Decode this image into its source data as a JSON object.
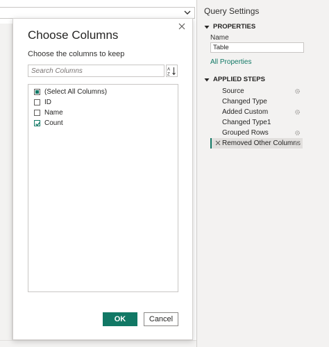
{
  "dialog": {
    "title": "Choose Columns",
    "subtitle": "Choose the columns to keep",
    "search_placeholder": "Search Columns",
    "columns": [
      {
        "label": "(Select All Columns)",
        "state": "partial"
      },
      {
        "label": "ID",
        "state": "unchecked"
      },
      {
        "label": "Name",
        "state": "unchecked"
      },
      {
        "label": "Count",
        "state": "checked"
      }
    ],
    "ok_label": "OK",
    "cancel_label": "Cancel"
  },
  "query_settings": {
    "title": "Query Settings",
    "properties_header": "PROPERTIES",
    "name_label": "Name",
    "name_value": "Table",
    "all_properties_link": "All Properties",
    "applied_steps_header": "APPLIED STEPS",
    "steps": [
      {
        "label": "Source",
        "gear": true,
        "active": false
      },
      {
        "label": "Changed Type",
        "gear": false,
        "active": false
      },
      {
        "label": "Added Custom",
        "gear": true,
        "active": false
      },
      {
        "label": "Changed Type1",
        "gear": false,
        "active": false
      },
      {
        "label": "Grouped Rows",
        "gear": true,
        "active": false
      },
      {
        "label": "Removed Other Columns",
        "gear": true,
        "active": true
      }
    ]
  },
  "colors": {
    "accent": "#117865",
    "pane_bg": "#f3f2f1",
    "active_step_bg": "#e1dfdd"
  },
  "icons": {
    "formula_expand": "chevron-down-icon",
    "dialog_close": "close-icon",
    "sort": "sort-az-icon",
    "section_toggle": "triangle-down-icon",
    "step_settings": "gear-icon",
    "step_delete": "delete-x-icon"
  }
}
